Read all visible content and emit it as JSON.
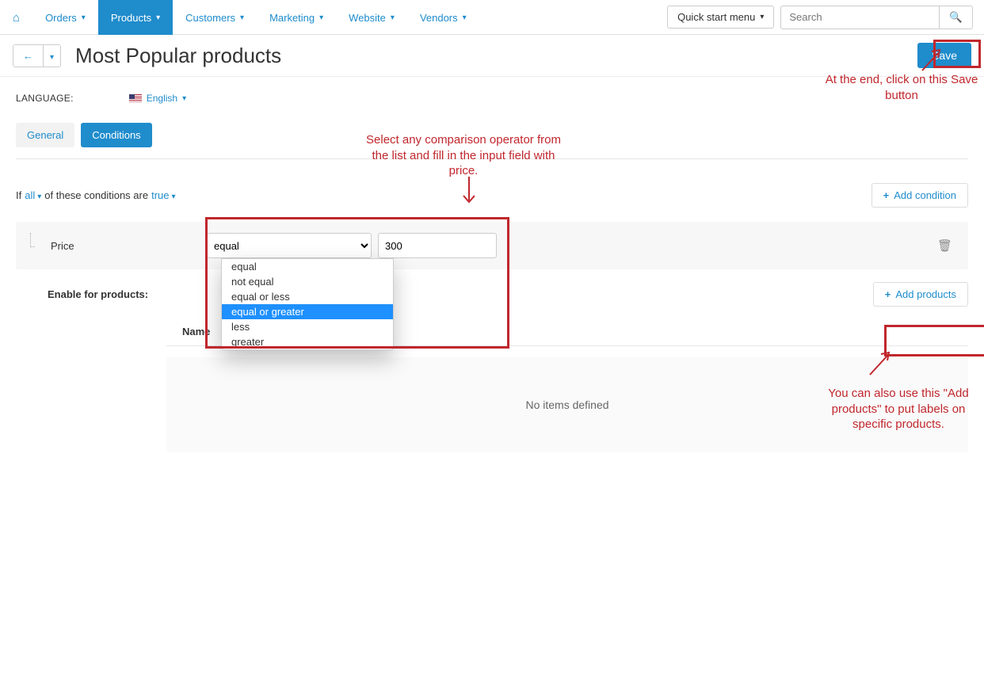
{
  "nav": {
    "items": [
      "Orders",
      "Products",
      "Customers",
      "Marketing",
      "Website",
      "Vendors"
    ],
    "active_index": 1,
    "quick_start": "Quick start menu",
    "search_placeholder": "Search"
  },
  "header": {
    "title": "Most Popular products",
    "save": "Save"
  },
  "language": {
    "label": "LANGUAGE:",
    "value": "English"
  },
  "tabs": {
    "general": "General",
    "conditions": "Conditions"
  },
  "conditions": {
    "sentence_prefix": "If",
    "all_token": "all",
    "sentence_mid": "of these conditions are",
    "true_token": "true",
    "add_condition": "Add condition",
    "row_label": "Price",
    "operator_selected": "equal",
    "operator_options": [
      "equal",
      "not equal",
      "equal or less",
      "equal or greater",
      "less",
      "greater"
    ],
    "operator_highlight_index": 3,
    "value": "300"
  },
  "products": {
    "enable_label": "Enable for products:",
    "add_products": "Add products",
    "name_header": "Name",
    "empty": "No items defined"
  },
  "annotations": {
    "top_center": "Select any comparison operator from the list and fill in the input field with price.",
    "save_note": "At the end, click on this Save button",
    "add_products_note": "You can also use this \"Add products\" to put labels on specific products."
  }
}
